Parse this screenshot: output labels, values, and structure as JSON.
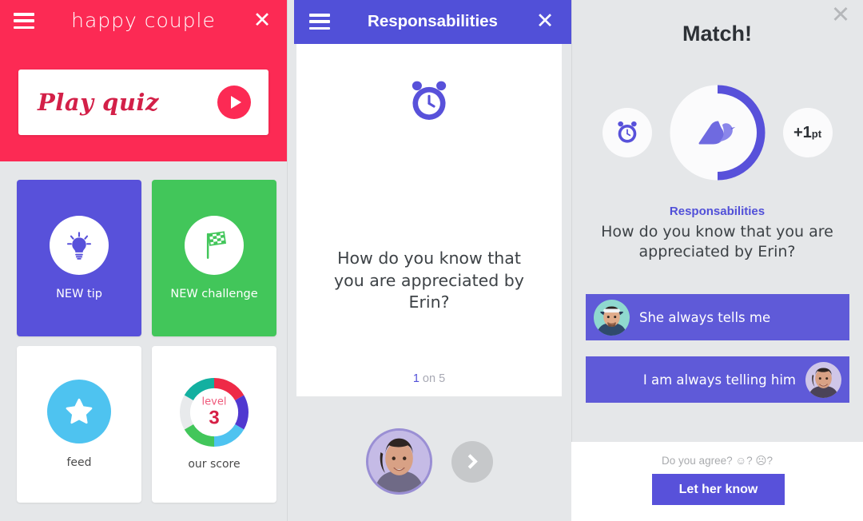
{
  "panel_home": {
    "brand": "happy couple",
    "menu_icon": "hamburger-icon",
    "close_icon": "close-icon",
    "play_label": "Play quiz",
    "play_icon": "play-icon",
    "tiles": [
      {
        "label": "NEW tip",
        "icon": "lightbulb-icon",
        "color": "#5851da"
      },
      {
        "label": "NEW challenge",
        "icon": "checkered-flag-icon",
        "color": "#42c65a"
      },
      {
        "label": "feed",
        "icon": "star-icon",
        "color": "#4ec3f0"
      },
      {
        "label": "our score",
        "icon": "level-donut-icon",
        "color": "#ffffff"
      }
    ],
    "score": {
      "level_label": "level",
      "level_value": "3"
    }
  },
  "panel_quiz": {
    "title": "Responsabilities",
    "menu_icon": "hamburger-icon",
    "close_icon": "close-icon",
    "category_icon": "alarm-clock-icon",
    "question": "How do you know that you are appreciated by Erin?",
    "counter_current": "1",
    "counter_rest": " on 5",
    "avatar": "partner-avatar",
    "next_icon": "chevron-right-icon"
  },
  "panel_match": {
    "title": "Match!",
    "close_icon": "close-icon",
    "left_badge_icon": "alarm-clock-icon",
    "points_value": "+1",
    "points_unit": "pt",
    "ring_icon": "bird-icon",
    "ring_progress_percent": 50,
    "category": "Responsabilities",
    "question": "How do you know that you are appreciated by Erin?",
    "answers": [
      {
        "text": "She always tells me",
        "side": "left",
        "avatar": "him-avatar"
      },
      {
        "text": "I am always telling him",
        "side": "right",
        "avatar": "her-avatar"
      }
    ],
    "cta_question": "Do you agree? ☺? ☹?",
    "cta_button": "Let her know"
  },
  "colors": {
    "pink": "#fc2a54",
    "purple": "#5851da",
    "header_purple": "#5150d8",
    "green": "#42c65a",
    "blue": "#4ec3f0",
    "background": "#e5e7e9"
  }
}
